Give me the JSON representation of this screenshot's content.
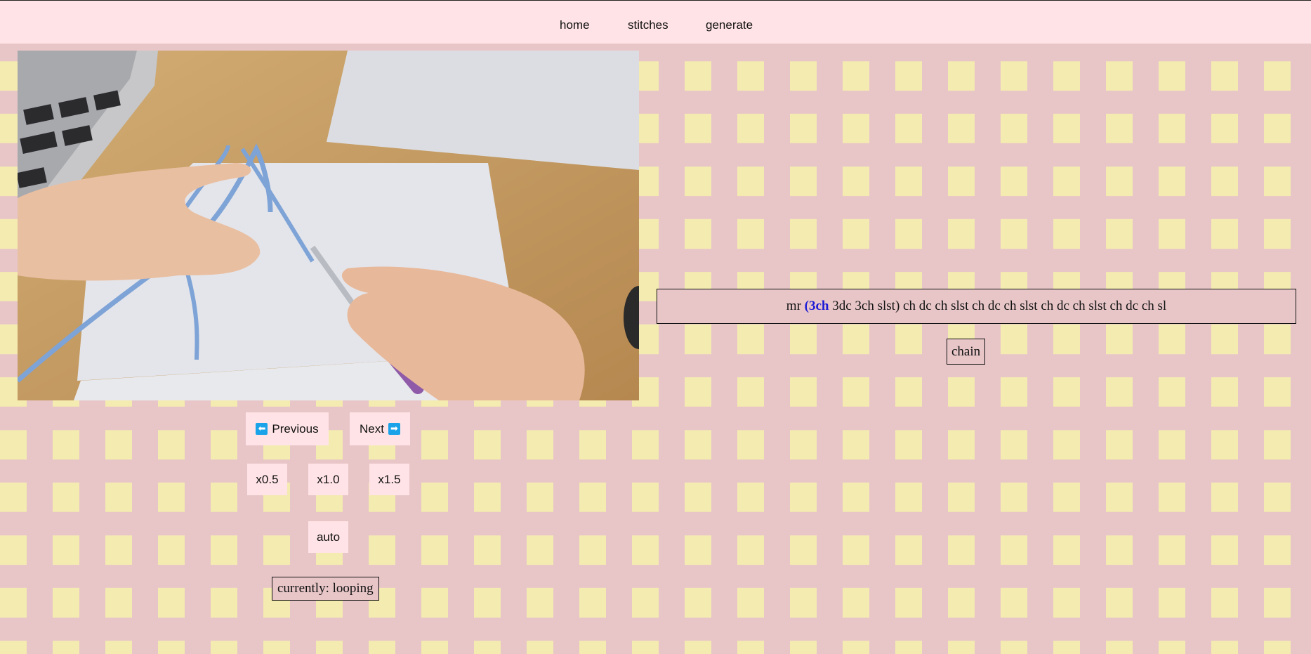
{
  "nav": {
    "home": "home",
    "stitches": "stitches",
    "generate": "generate"
  },
  "video": {
    "icon": "crochet-video-frame"
  },
  "controls": {
    "previous_label": "Previous",
    "previous_icon": "arrow-left-icon",
    "next_label": "Next",
    "next_icon": "arrow-right-icon",
    "speed_options": [
      "x0.5",
      "x1.0",
      "x1.5"
    ],
    "auto_label": "auto",
    "status_text": "currently: looping"
  },
  "pattern": {
    "prefix": "mr ",
    "highlighted": "(3ch",
    "rest": " 3dc 3ch slst) ch dc ch slst ch dc ch slst ch dc ch slst ch dc ch sl",
    "highlight_color": "#1a1ad6"
  },
  "current_stitch": "chain",
  "colors": {
    "nav_bg": "#ffe3e6",
    "stripe_pink": "#e8c6c8",
    "stripe_yellow": "#f4ebb0",
    "arrow_blue": "#1aa3e8"
  }
}
